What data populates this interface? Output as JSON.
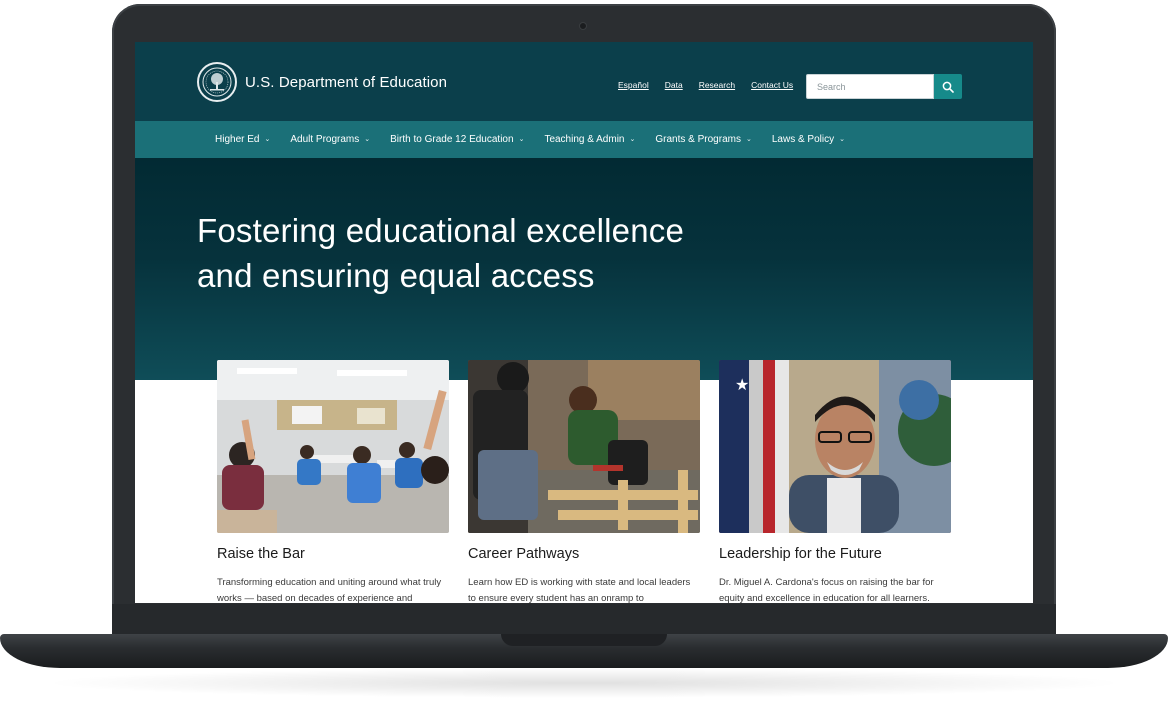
{
  "header": {
    "site_title": "U.S. Department of Education",
    "utility_links": [
      "Español",
      "Data",
      "Research",
      "Contact Us"
    ],
    "search": {
      "placeholder": "Search",
      "value": ""
    }
  },
  "nav": {
    "items": [
      {
        "label": "Higher Ed"
      },
      {
        "label": "Adult Programs"
      },
      {
        "label": "Birth to Grade 12 Education"
      },
      {
        "label": "Teaching & Admin"
      },
      {
        "label": "Grants & Programs"
      },
      {
        "label": "Laws & Policy"
      }
    ],
    "chevron": "⌄"
  },
  "hero": {
    "title": "Fostering educational excellence and ensuring equal access"
  },
  "cards": [
    {
      "title": "Raise the Bar",
      "desc": "Transforming education and uniting around what truly works — based on decades of experience and",
      "image_icon": "classroom-photo"
    },
    {
      "title": "Career Pathways",
      "desc": "Learn how ED is working with state and local leaders to ensure every student has an onramp to",
      "image_icon": "workshop-photo"
    },
    {
      "title": "Leadership for the Future",
      "desc": "Dr. Miguel A. Cardona's focus on raising the bar for equity and excellence in education for all learners.",
      "image_icon": "portrait-photo"
    }
  ],
  "colors": {
    "header_bg": "#0b3f4b",
    "nav_bg": "#1b7078",
    "hero_top": "#022a33",
    "accent": "#168a8a"
  }
}
